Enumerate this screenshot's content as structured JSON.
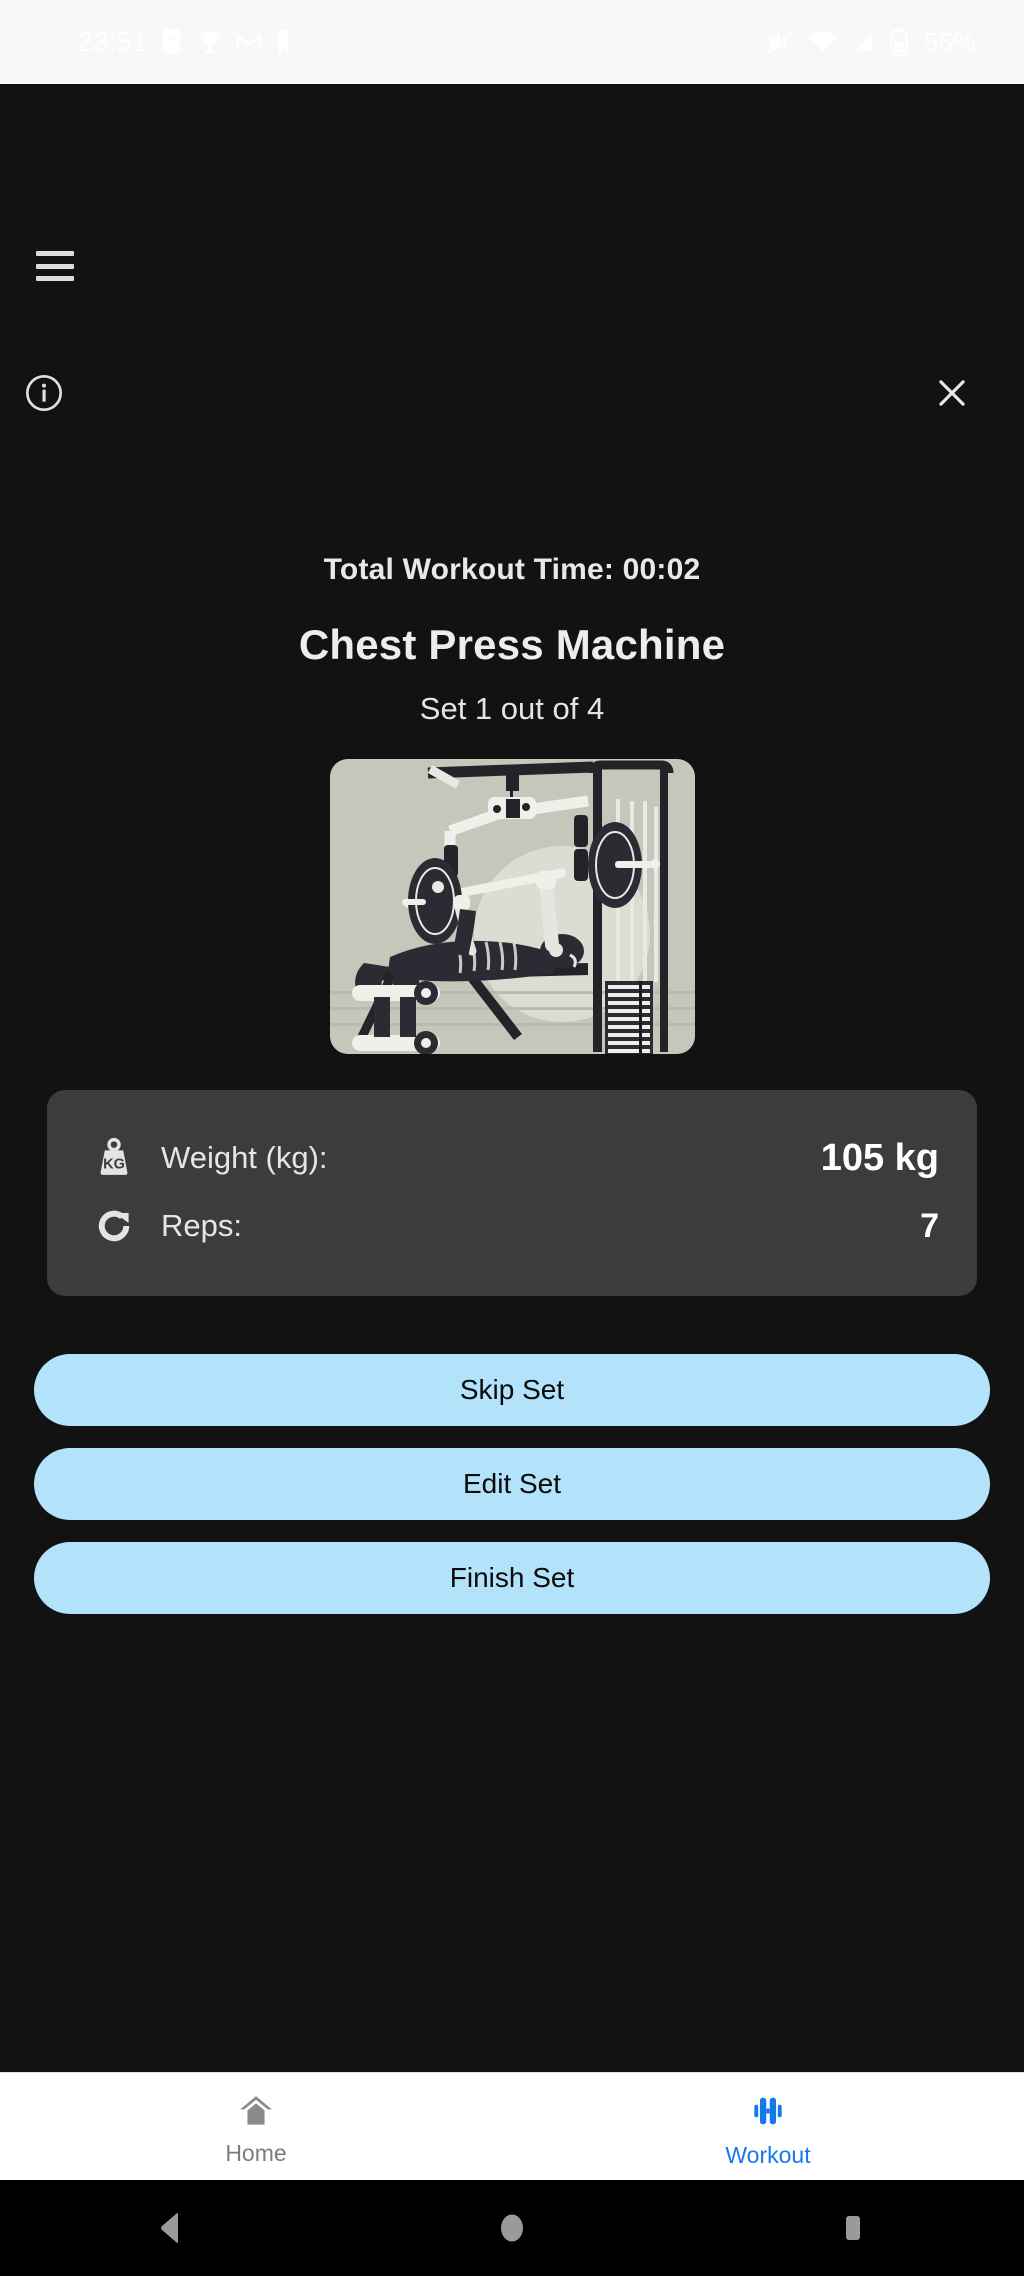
{
  "status_bar": {
    "time": "23:51",
    "battery_percent": "56%",
    "icons": [
      "call-forward-icon",
      "trophy-icon",
      "gmail-icon",
      "bookmark-icon",
      "mute-icon",
      "wifi-icon",
      "signal-icon",
      "battery-icon"
    ]
  },
  "header": {
    "menu_icon": "hamburger-menu-icon",
    "info_icon": "info-circle-icon",
    "close_icon": "close-x-icon"
  },
  "main": {
    "total_time_label": "Total Workout Time: 00:02",
    "exercise_name": "Chest Press Machine",
    "set_counter": "Set 1 out of 4",
    "illustration_name": "chest-press-machine-illustration"
  },
  "stats": {
    "rows": [
      {
        "icon": "weight-kg-icon",
        "label": "Weight (kg):",
        "value": "105 kg"
      },
      {
        "icon": "reps-refresh-icon",
        "label": "Reps:",
        "value": "7"
      }
    ]
  },
  "actions": {
    "buttons": [
      {
        "name": "skip-set-button",
        "label": "Skip Set"
      },
      {
        "name": "edit-set-button",
        "label": "Edit Set"
      },
      {
        "name": "finish-set-button",
        "label": "Finish Set"
      }
    ]
  },
  "bottom_nav": {
    "items": [
      {
        "name": "home",
        "label": "Home",
        "icon": "home-icon",
        "active": false
      },
      {
        "name": "workout",
        "label": "Workout",
        "icon": "dumbbell-icon",
        "active": true
      }
    ]
  },
  "android_nav": {
    "back": "back-triangle-icon",
    "home": "home-circle-icon",
    "recents": "recents-square-icon"
  },
  "colors": {
    "background": "#121212",
    "card": "#3c3c3c",
    "button": "#b3e3fa",
    "accent": "#1479ee",
    "illustration_bg": "#c6c7bb",
    "status_bar_bg": "#f7f8f8"
  }
}
